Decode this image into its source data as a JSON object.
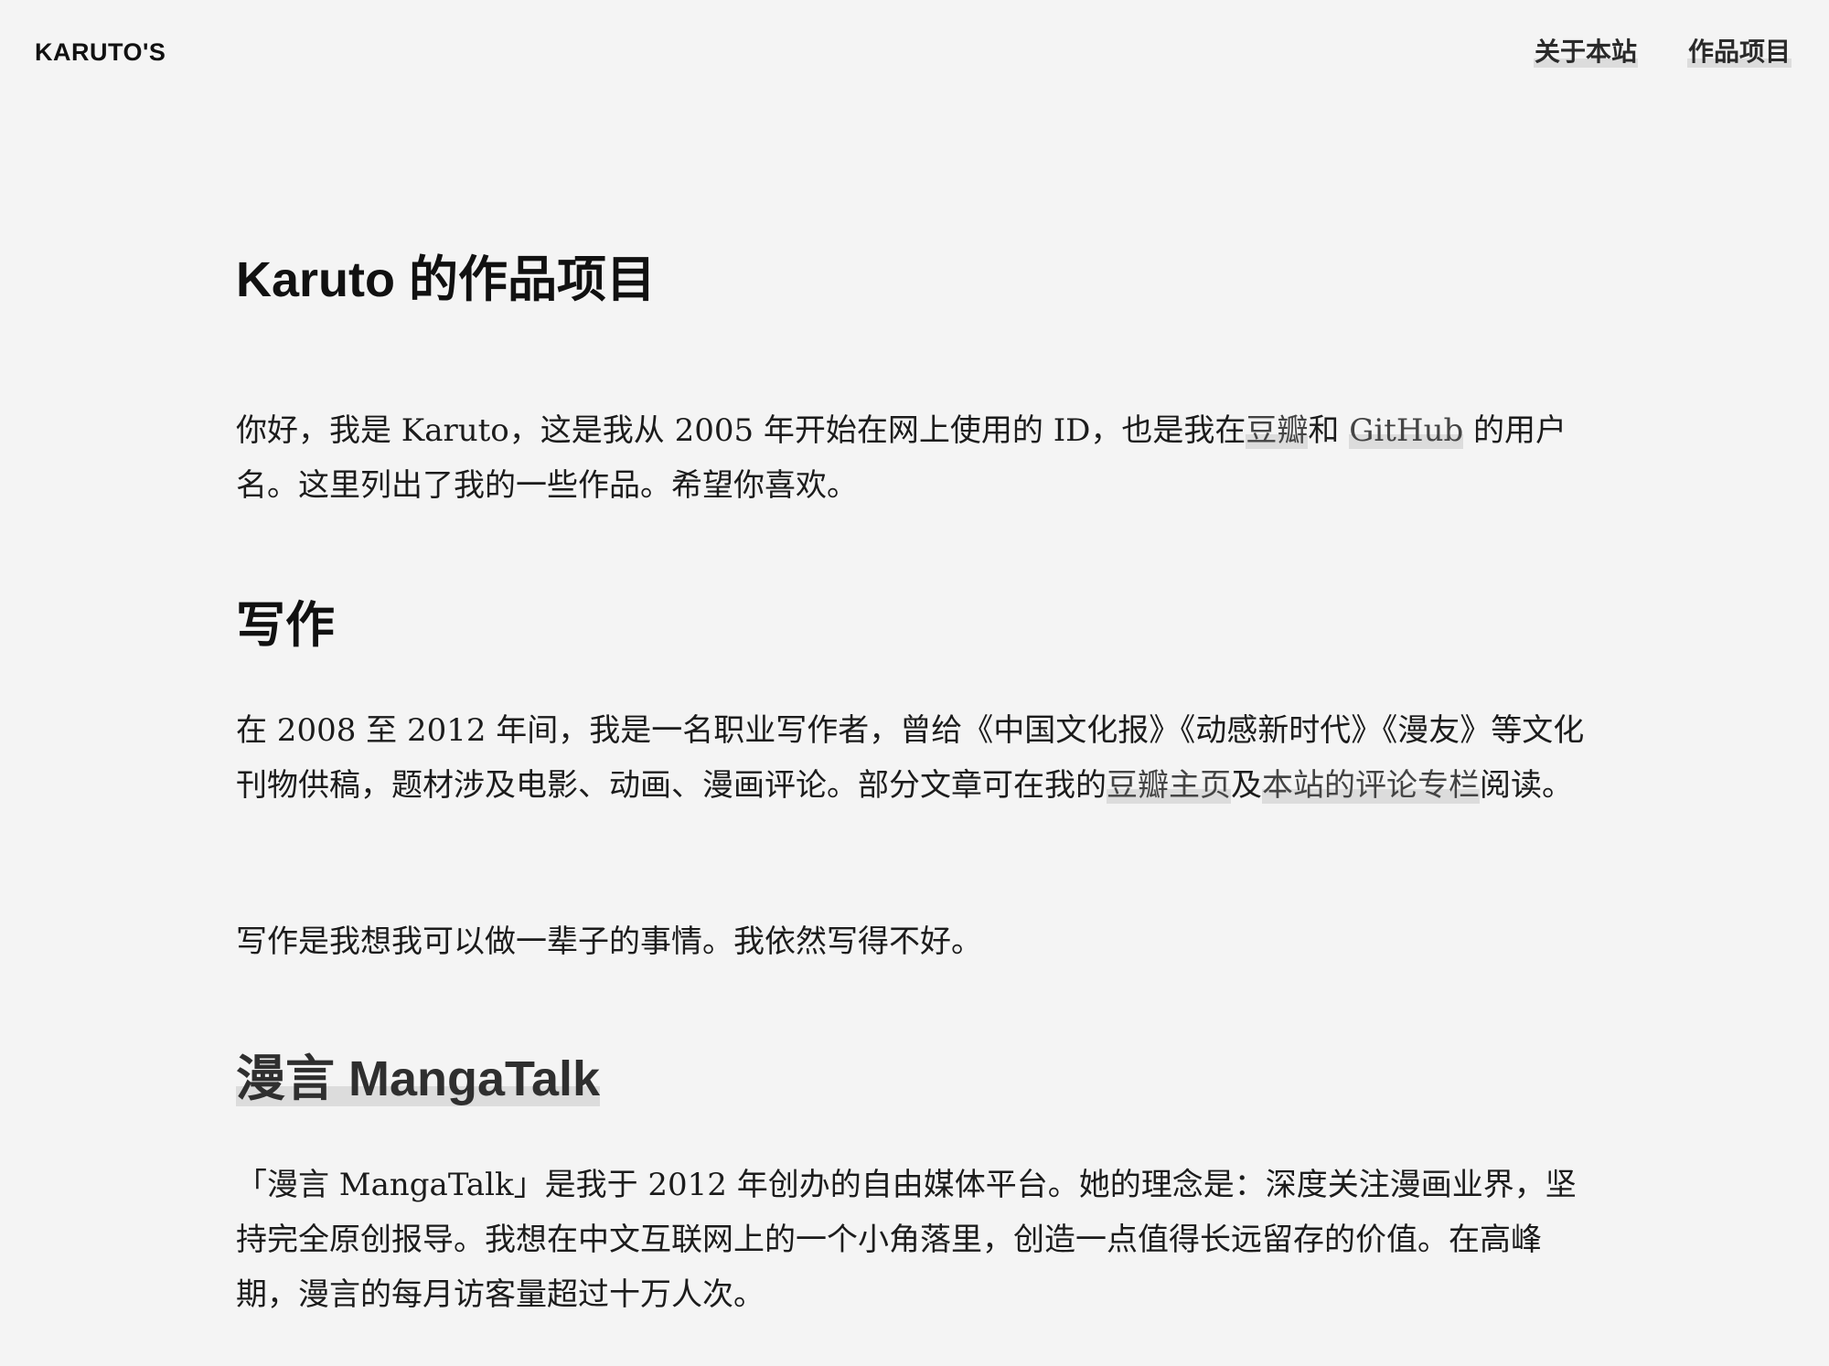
{
  "header": {
    "site_title": "KARUTO'S",
    "nav": [
      {
        "label": "关于本站"
      },
      {
        "label": "作品项目"
      }
    ]
  },
  "page": {
    "title": "Karuto 的作品项目"
  },
  "intro": {
    "text_before_link1": "你好，我是 Karuto，这是我从 2005 年开始在网上使用的 ID，也是我在",
    "link1": "豆瓣",
    "text_between": "和 ",
    "link2": "GitHub",
    "text_after": " 的用户名。这里列出了我的一些作品。希望你喜欢。"
  },
  "writing": {
    "heading": "写作",
    "p1_before": "在 2008 至 2012 年间，我是一名职业写作者，曾给《中国文化报》《动感新时代》《漫友》等文化刊物供稿，题材涉及电影、动画、漫画评论。部分文章可在我的",
    "p1_link1": "豆瓣主页",
    "p1_between": "及",
    "p1_link2": "本站的评论专栏",
    "p1_after": "阅读。",
    "p2": "写作是我想我可以做一辈子的事情。我依然写得不好。"
  },
  "mangatalk": {
    "heading": "漫言 MangaTalk",
    "p1": "「漫言 MangaTalk」是我于 2012 年创办的自由媒体平台。她的理念是：深度关注漫画业界，坚持完全原创报导。我想在中文互联网上的一个小角落里，创造一点值得长远留存的价值。在高峰期，漫言的每月访客量超过十万人次。"
  },
  "colors": {
    "background": "#f4f4f4",
    "text": "#1c1c1c",
    "link_highlight": "#dcdcdc"
  }
}
